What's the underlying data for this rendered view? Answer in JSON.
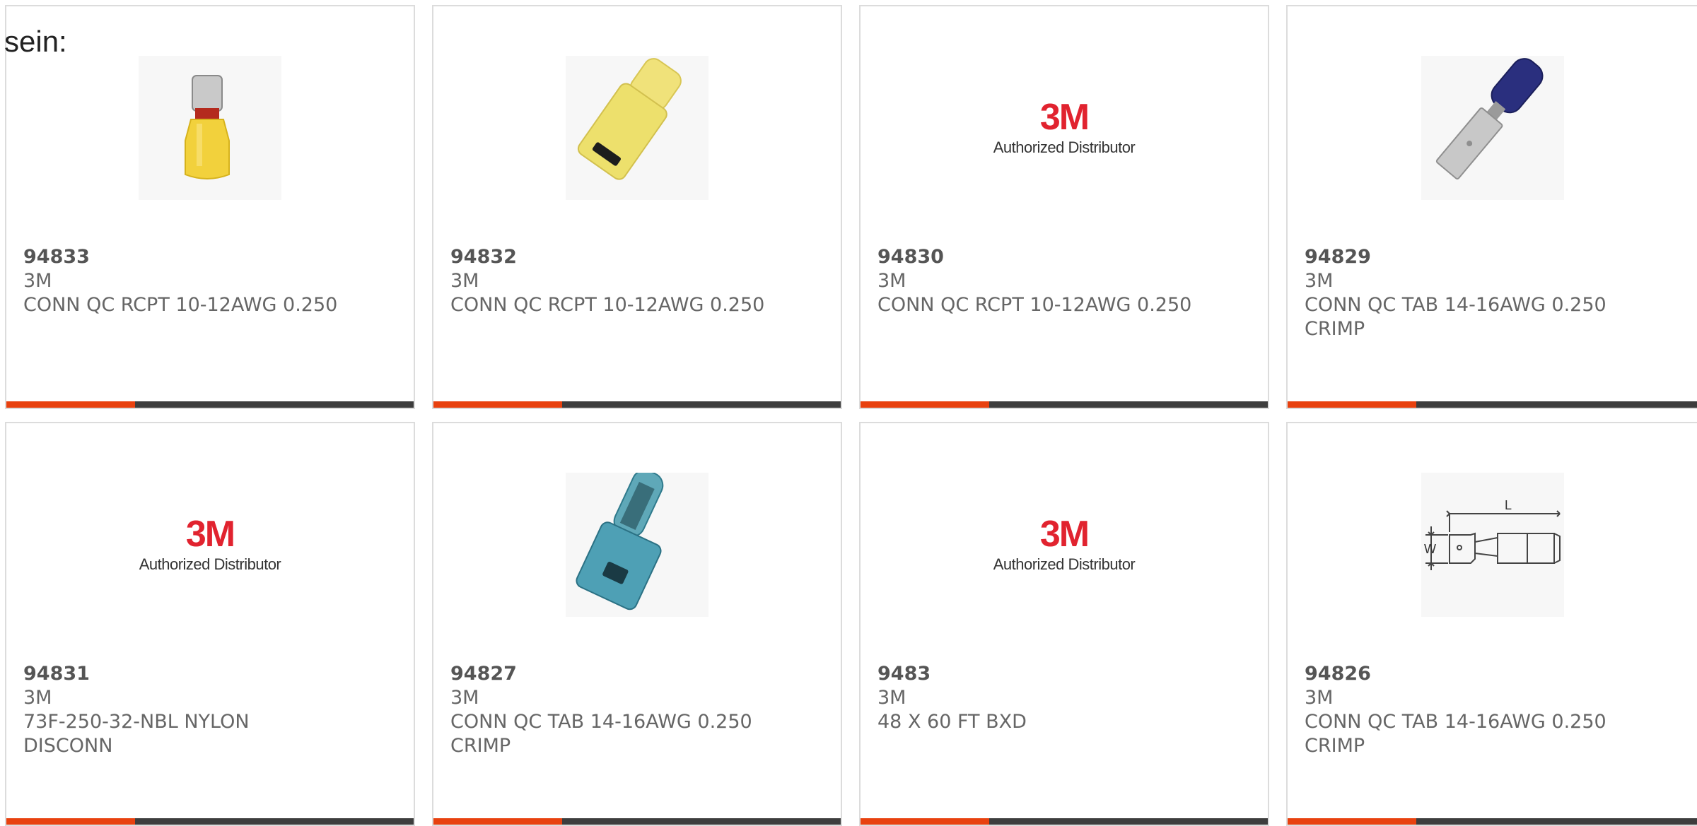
{
  "intro_text": "sein:",
  "colors": {
    "accent": "#e8410f",
    "bar_dark": "#3d3d3d",
    "logo_red": "#e1232f"
  },
  "products": [
    {
      "part": "94833",
      "brand": "3M",
      "desc": "CONN QC RCPT 10-12AWG 0.250",
      "image": "yellow-receptacle-photo"
    },
    {
      "part": "94832",
      "brand": "3M",
      "desc": "CONN QC RCPT 10-12AWG 0.250",
      "image": "yellow-nylon-receptacle-photo"
    },
    {
      "part": "94830",
      "brand": "3M",
      "desc": "CONN QC RCPT 10-12AWG 0.250",
      "image": "3m-authorized-distributor-logo"
    },
    {
      "part": "94829",
      "brand": "3M",
      "desc": "CONN QC TAB 14-16AWG 0.250 CRIMP",
      "image": "blue-tab-photo"
    },
    {
      "part": "94831",
      "brand": "3M",
      "desc": "73F-250-32-NBL NYLON DISCONN",
      "image": "3m-authorized-distributor-logo"
    },
    {
      "part": "94827",
      "brand": "3M",
      "desc": "CONN QC TAB 14-16AWG 0.250 CRIMP",
      "image": "blue-nylon-tab-photo"
    },
    {
      "part": "9483",
      "brand": "3M",
      "desc": "48 X 60 FT BXD",
      "image": "3m-authorized-distributor-logo"
    },
    {
      "part": "94826",
      "brand": "3M",
      "desc": "CONN QC TAB 14-16AWG 0.250 CRIMP",
      "image": "tab-dimension-drawing"
    }
  ],
  "logo": {
    "mark": "3M",
    "sub": "Authorized Distributor"
  },
  "drawing": {
    "label_l": "L",
    "label_w": "W"
  }
}
